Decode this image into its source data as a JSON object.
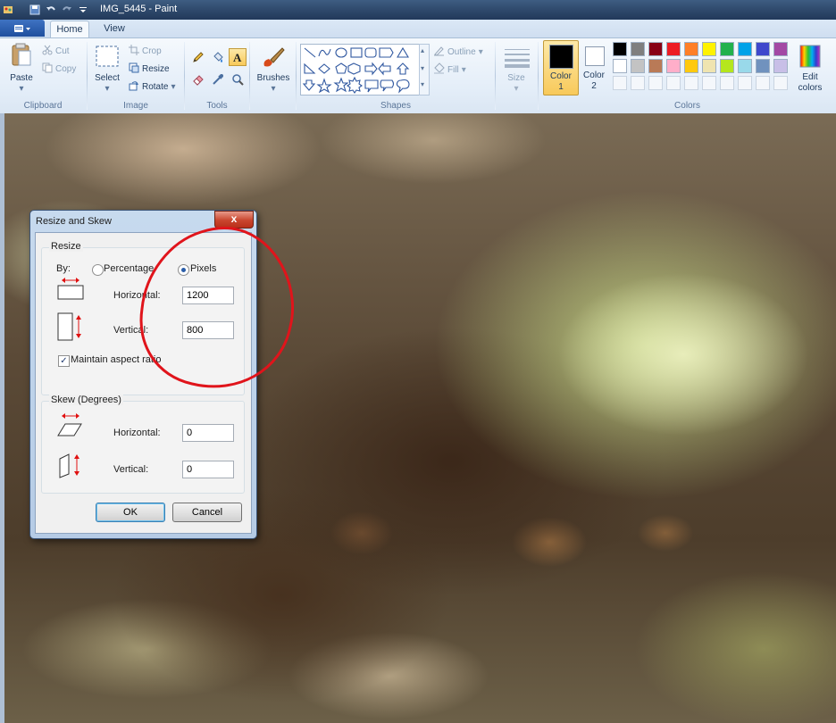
{
  "window": {
    "title": "IMG_5445 - Paint"
  },
  "ribbon": {
    "tabs": [
      {
        "label": "Home"
      },
      {
        "label": "View"
      }
    ],
    "clipboard": {
      "paste": "Paste",
      "cut": "Cut",
      "copy": "Copy",
      "group": "Clipboard"
    },
    "image": {
      "select": "Select",
      "crop": "Crop",
      "resize": "Resize",
      "rotate": "Rotate",
      "group": "Image"
    },
    "tools": {
      "group": "Tools"
    },
    "brushes": {
      "label": "Brushes"
    },
    "shapes": {
      "outline": "Outline",
      "fill": "Fill",
      "group": "Shapes"
    },
    "size": {
      "label": "Size"
    },
    "colors": {
      "color1_line1": "Color",
      "color1_line2": "1",
      "color2_line1": "Color",
      "color2_line2": "2",
      "edit_line1": "Edit",
      "edit_line2": "colors",
      "group": "Colors",
      "color1": "#000000",
      "color2": "#ffffff",
      "palette_row1": [
        "#000000",
        "#7f7f7f",
        "#880015",
        "#ed1c24",
        "#ff7f27",
        "#fff200",
        "#22b14c",
        "#00a2e8",
        "#3f48cc",
        "#a349a4"
      ],
      "palette_row2": [
        "#ffffff",
        "#c3c3c3",
        "#b97a57",
        "#ffaec9",
        "#ffc90e",
        "#efe4b0",
        "#b5e61d",
        "#99d9ea",
        "#7092be",
        "#c8bfe7"
      ]
    }
  },
  "dialog": {
    "title": "Resize and Skew",
    "close": "x",
    "resize": {
      "legend": "Resize",
      "by_label": "By:",
      "option_percentage": "Percentage",
      "option_pixels": "Pixels",
      "selected": "Pixels",
      "horizontal_label": "Horizontal:",
      "horizontal_value": "1200",
      "vertical_label": "Vertical:",
      "vertical_value": "800",
      "maintain_label": "Maintain aspect ratio",
      "maintain_checked": true
    },
    "skew": {
      "legend": "Skew (Degrees)",
      "horizontal_label": "Horizontal:",
      "horizontal_value": "0",
      "vertical_label": "Vertical:",
      "vertical_value": "0"
    },
    "ok": "OK",
    "cancel": "Cancel"
  },
  "annotation": {
    "color": "#e0141b"
  }
}
